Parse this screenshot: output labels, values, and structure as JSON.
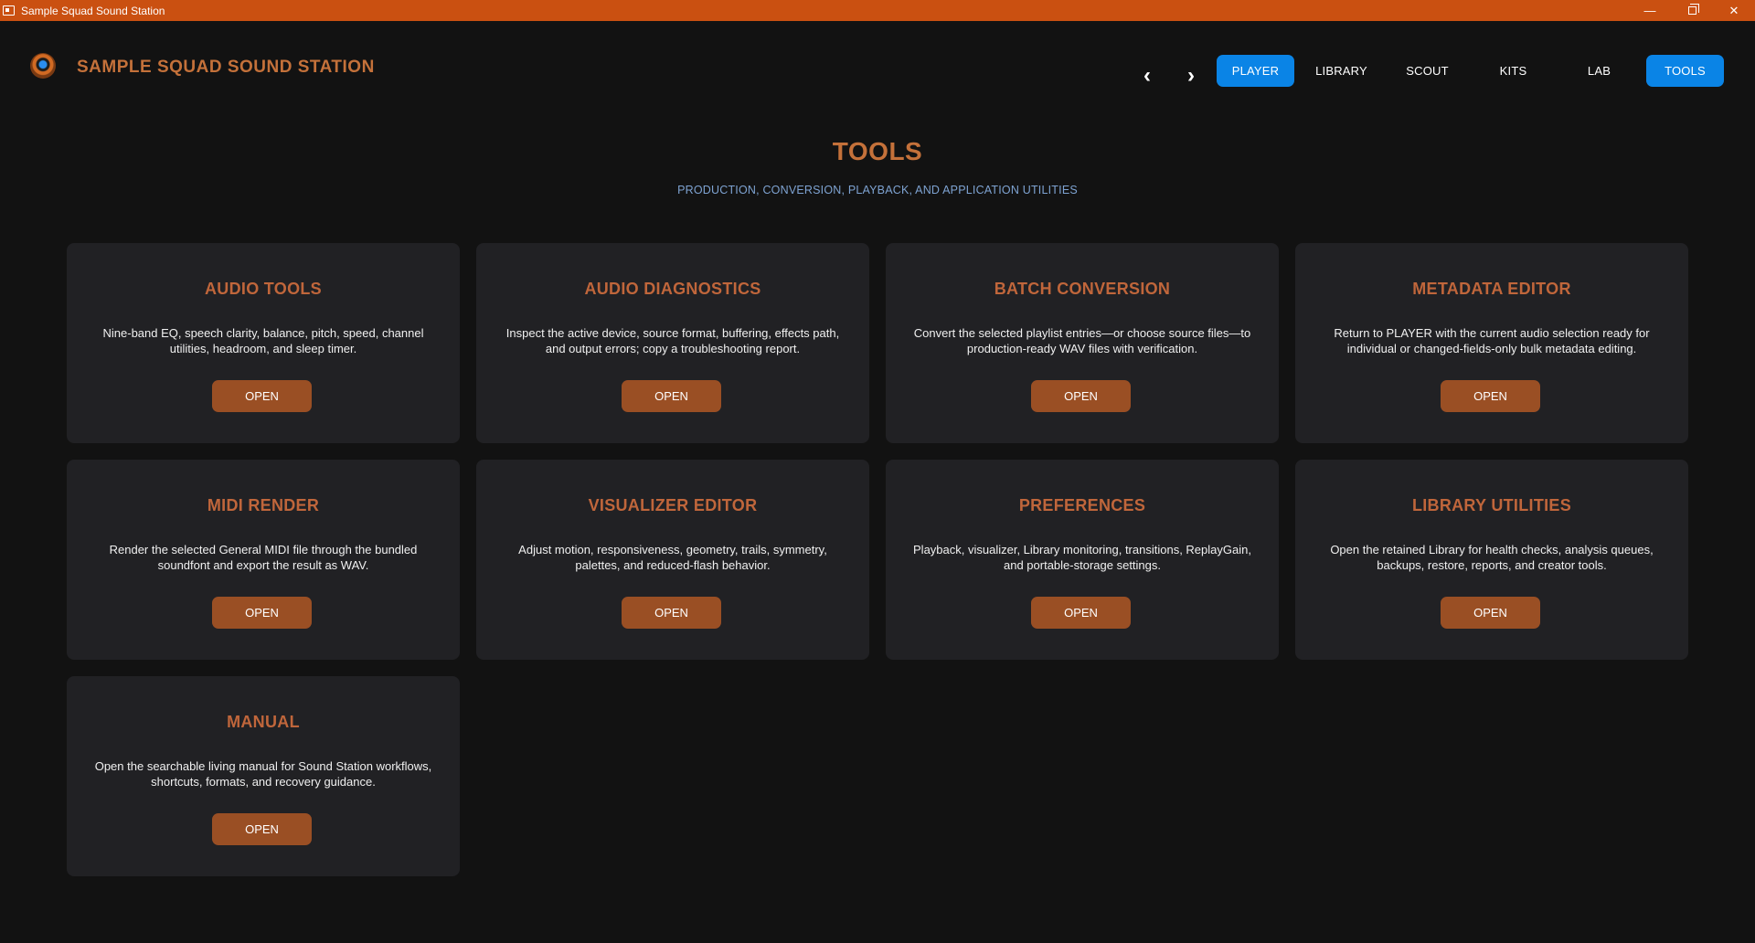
{
  "window": {
    "title": "Sample Squad Sound Station",
    "controls": {
      "minimize": "—",
      "close": "✕"
    }
  },
  "header": {
    "app_name": "SAMPLE SQUAD SOUND STATION",
    "back_arrow": "‹",
    "forward_arrow": "›",
    "tabs": [
      {
        "label": "PLAYER",
        "active": true
      },
      {
        "label": "LIBRARY",
        "active": false
      },
      {
        "label": "SCOUT",
        "active": false
      },
      {
        "label": "KITS",
        "active": false
      },
      {
        "label": "LAB",
        "active": false
      },
      {
        "label": "TOOLS",
        "active": true
      }
    ]
  },
  "page": {
    "title": "TOOLS",
    "subtitle": "PRODUCTION, CONVERSION, PLAYBACK, AND APPLICATION UTILITIES"
  },
  "cards": [
    {
      "title": "AUDIO TOOLS",
      "description": "Nine-band EQ, speech clarity, balance, pitch, speed, channel utilities, headroom, and sleep timer.",
      "button": "OPEN"
    },
    {
      "title": "AUDIO DIAGNOSTICS",
      "description": "Inspect the active device, source format, buffering, effects path, and output errors; copy a troubleshooting report.",
      "button": "OPEN"
    },
    {
      "title": "BATCH CONVERSION",
      "description": "Convert the selected playlist entries—or choose source files—to production-ready WAV files with verification.",
      "button": "OPEN"
    },
    {
      "title": "METADATA EDITOR",
      "description": "Return to PLAYER with the current audio selection ready for individual or changed-fields-only bulk metadata editing.",
      "button": "OPEN"
    },
    {
      "title": "MIDI RENDER",
      "description": "Render the selected General MIDI file through the bundled soundfont and export the result as WAV.",
      "button": "OPEN"
    },
    {
      "title": "VISUALIZER EDITOR",
      "description": "Adjust motion, responsiveness, geometry, trails, symmetry, palettes, and reduced-flash behavior.",
      "button": "OPEN"
    },
    {
      "title": "PREFERENCES",
      "description": "Playback, visualizer, Library monitoring, transitions, ReplayGain, and portable-storage settings.",
      "button": "OPEN"
    },
    {
      "title": "LIBRARY UTILITIES",
      "description": "Open the retained Library for health checks, analysis queues, backups, restore, reports, and creator tools.",
      "button": "OPEN"
    },
    {
      "title": "MANUAL",
      "description": "Open the searchable living manual for Sound Station workflows, shortcuts, formats, and recovery guidance.",
      "button": "OPEN"
    }
  ],
  "colors": {
    "titlebar": "#ca5011",
    "accent": "#c4713a",
    "active_tab": "#0a84e6",
    "button": "#9a4f24",
    "card_bg": "#212124",
    "page_bg": "#121212",
    "subtitle": "#7ea3d2"
  }
}
